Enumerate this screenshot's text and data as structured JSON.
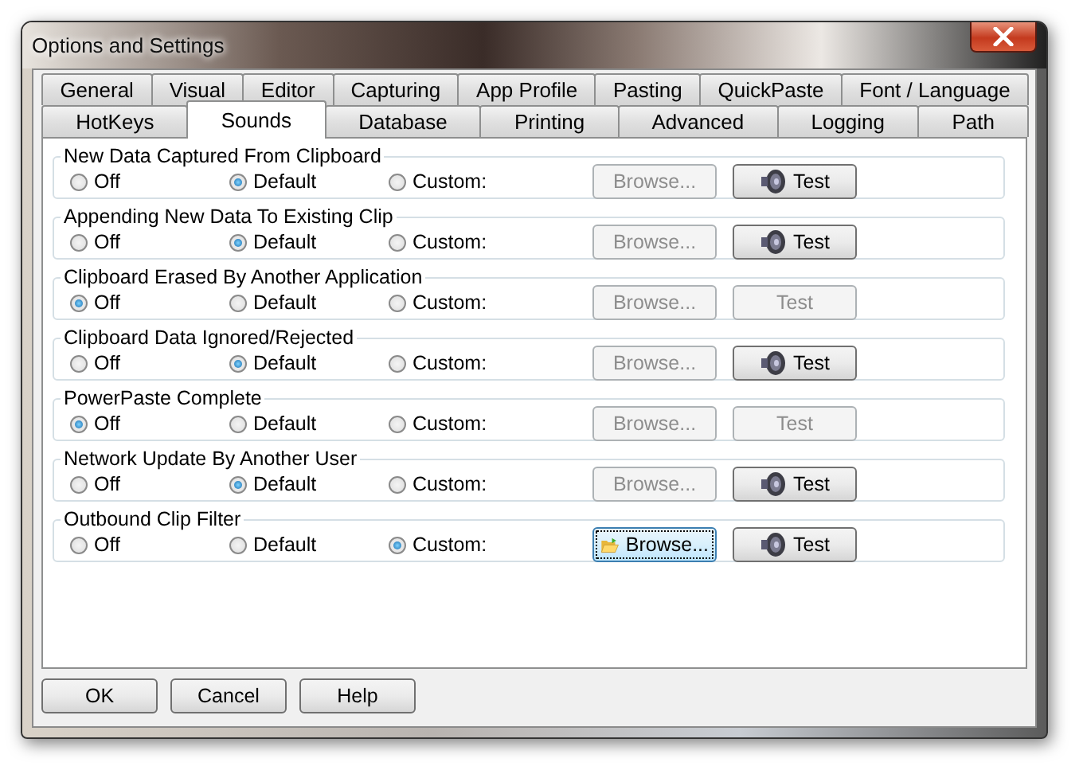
{
  "window": {
    "title": "Options and Settings"
  },
  "tab_rows": [
    [
      {
        "label": "General",
        "selected": false
      },
      {
        "label": "Visual",
        "selected": false
      },
      {
        "label": "Editor",
        "selected": false
      },
      {
        "label": "Capturing",
        "selected": false
      },
      {
        "label": "App Profile",
        "selected": false
      },
      {
        "label": "Pasting",
        "selected": false
      },
      {
        "label": "QuickPaste",
        "selected": false
      },
      {
        "label": "Font / Language",
        "selected": false
      }
    ],
    [
      {
        "label": "HotKeys",
        "selected": false
      },
      {
        "label": "Sounds",
        "selected": true
      },
      {
        "label": "Database",
        "selected": false
      },
      {
        "label": "Printing",
        "selected": false
      },
      {
        "label": "Advanced",
        "selected": false
      },
      {
        "label": "Logging",
        "selected": false
      },
      {
        "label": "Path",
        "selected": false
      }
    ]
  ],
  "groups": [
    {
      "title": "New Data Captured From Clipboard",
      "options": [
        {
          "label": "Off",
          "selected": false
        },
        {
          "label": "Default",
          "selected": true
        },
        {
          "label": "Custom:",
          "selected": false
        }
      ],
      "browse": {
        "label": "Browse...",
        "disabled": true,
        "focused": false
      },
      "test": {
        "label": "Test",
        "disabled": false
      }
    },
    {
      "title": "Appending New Data To Existing Clip",
      "options": [
        {
          "label": "Off",
          "selected": false
        },
        {
          "label": "Default",
          "selected": true
        },
        {
          "label": "Custom:",
          "selected": false
        }
      ],
      "browse": {
        "label": "Browse...",
        "disabled": true,
        "focused": false
      },
      "test": {
        "label": "Test",
        "disabled": false
      }
    },
    {
      "title": "Clipboard Erased By Another Application",
      "options": [
        {
          "label": "Off",
          "selected": true
        },
        {
          "label": "Default",
          "selected": false
        },
        {
          "label": "Custom:",
          "selected": false
        }
      ],
      "browse": {
        "label": "Browse...",
        "disabled": true,
        "focused": false
      },
      "test": {
        "label": "Test",
        "disabled": true
      }
    },
    {
      "title": "Clipboard Data Ignored/Rejected",
      "options": [
        {
          "label": "Off",
          "selected": false
        },
        {
          "label": "Default",
          "selected": true
        },
        {
          "label": "Custom:",
          "selected": false
        }
      ],
      "browse": {
        "label": "Browse...",
        "disabled": true,
        "focused": false
      },
      "test": {
        "label": "Test",
        "disabled": false
      }
    },
    {
      "title": "PowerPaste Complete",
      "options": [
        {
          "label": "Off",
          "selected": true
        },
        {
          "label": "Default",
          "selected": false
        },
        {
          "label": "Custom:",
          "selected": false
        }
      ],
      "browse": {
        "label": "Browse...",
        "disabled": true,
        "focused": false
      },
      "test": {
        "label": "Test",
        "disabled": true
      }
    },
    {
      "title": "Network Update By Another User",
      "options": [
        {
          "label": "Off",
          "selected": false
        },
        {
          "label": "Default",
          "selected": true
        },
        {
          "label": "Custom:",
          "selected": false
        }
      ],
      "browse": {
        "label": "Browse...",
        "disabled": true,
        "focused": false
      },
      "test": {
        "label": "Test",
        "disabled": false
      }
    },
    {
      "title": "Outbound Clip Filter",
      "options": [
        {
          "label": "Off",
          "selected": false
        },
        {
          "label": "Default",
          "selected": false
        },
        {
          "label": "Custom:",
          "selected": true
        }
      ],
      "browse": {
        "label": "Browse...",
        "disabled": false,
        "focused": true
      },
      "test": {
        "label": "Test",
        "disabled": false
      }
    }
  ],
  "buttons": [
    "OK",
    "Cancel",
    "Help"
  ]
}
